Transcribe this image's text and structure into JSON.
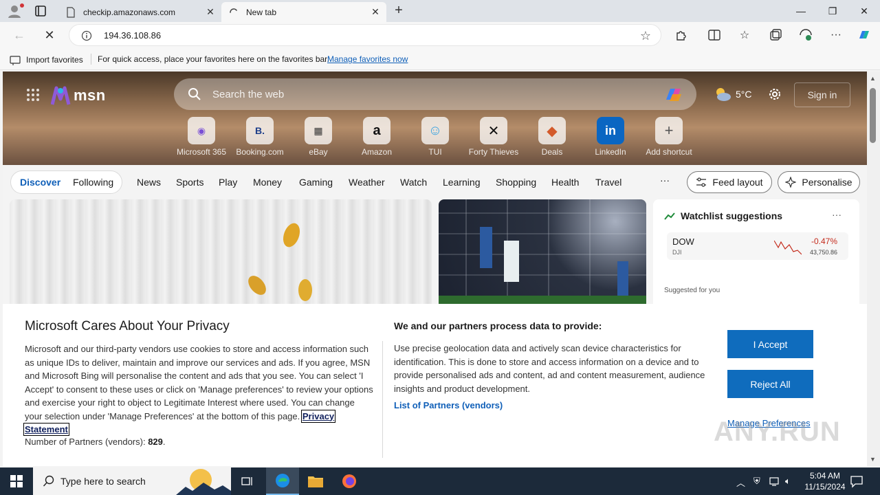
{
  "browser": {
    "tabs": [
      {
        "title": "checkip.amazonaws.com",
        "active": false
      },
      {
        "title": "New tab",
        "active": true
      }
    ],
    "new_tab_glyph": "+",
    "window_controls": {
      "minimize": "—",
      "maximize": "❐",
      "close": "✕"
    },
    "address": "194.36.108.86",
    "favorites_bar": {
      "import_label": "Import favorites",
      "hint": "For quick access, place your favorites here on the favorites bar.",
      "manage_link": "Manage favorites now"
    }
  },
  "msn": {
    "logo_text": "msn",
    "search_placeholder": "Search the web",
    "weather": "5°C",
    "sign_in": "Sign in",
    "shortcuts": [
      {
        "label": "Microsoft 365",
        "icon": "microsoft-365-icon",
        "glyph": "◉",
        "color": "#7a4fd6"
      },
      {
        "label": "Booking.com",
        "icon": "booking-icon",
        "glyph": "B.",
        "color": "#1e3f8a"
      },
      {
        "label": "eBay",
        "icon": "ebay-icon",
        "glyph": "▦",
        "color": "#333333"
      },
      {
        "label": "Amazon",
        "icon": "amazon-icon",
        "glyph": "a",
        "color": "#111111"
      },
      {
        "label": "TUI",
        "icon": "tui-icon",
        "glyph": "☺",
        "color": "#39a2e0"
      },
      {
        "label": "Forty Thieves",
        "icon": "forty-thieves-icon",
        "glyph": "✕",
        "color": "#111111"
      },
      {
        "label": "Deals",
        "icon": "deals-icon",
        "glyph": "◆",
        "color": "#d35a2a"
      },
      {
        "label": "LinkedIn",
        "icon": "linkedin-icon",
        "glyph": "in",
        "color": "#0a66c2"
      },
      {
        "label": "Add shortcut",
        "icon": "add-shortcut-icon",
        "glyph": "+",
        "color": "#555555"
      }
    ],
    "feed_tabs": {
      "discover": "Discover",
      "following": "Following"
    },
    "nav": [
      "News",
      "Sports",
      "Play",
      "Money",
      "Gaming",
      "Weather",
      "Watch",
      "Learning",
      "Shopping",
      "Health",
      "Travel"
    ],
    "nav_more": "···",
    "feed_layout": "Feed layout",
    "personalise": "Personalise",
    "watchlist": {
      "title": "Watchlist suggestions",
      "more": "···",
      "stock": {
        "symbol": "DOW",
        "exchange": "DJI",
        "change": "-0.47%",
        "value": "43,750.86"
      },
      "suggested": "Suggested for you"
    }
  },
  "privacy": {
    "title": "Microsoft Cares About Your Privacy",
    "body": "Microsoft and our third-party vendors use cookies to store and access information such as unique IDs to deliver, maintain and improve our services and ads. If you agree, MSN and Microsoft Bing will personalise the content and ads that you see. You can select 'I Accept' to consent to these uses or click on 'Manage preferences' to review your options and exercise your right to object to Legitimate Interest where used.  You can change your selection under 'Manage Preferences' at the bottom of this page.",
    "privacy_link": "Privacy Statement",
    "partners_label": "Number of Partners (vendors): ",
    "partners_count": "829",
    "partners_suffix": ".",
    "process_title": "We and our partners process data to provide:",
    "process_body": "Use precise geolocation data and actively scan device characteristics for identification. This is done to store and access information on a device and to provide personalised ads and content, ad and content measurement, audience insights and product development.",
    "vendors_link": "List of Partners (vendors)",
    "accept": "I Accept",
    "reject": "Reject All",
    "manage": "Manage Preferences"
  },
  "watermark": "ANY.RUN",
  "taskbar": {
    "search_placeholder": "Type here to search",
    "time": "5:04 AM",
    "date": "11/15/2024"
  }
}
